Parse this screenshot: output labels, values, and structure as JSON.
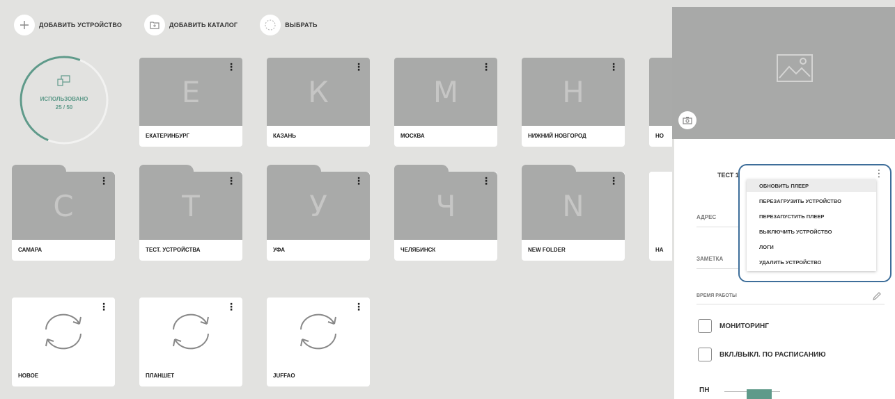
{
  "toolbar": {
    "add_device": "ДОБАВИТЬ УСТРОЙСТВО",
    "add_catalog": "ДОБАВИТЬ КАТАЛОГ",
    "select": "ВЫБРАТЬ"
  },
  "usage": {
    "label": "ИСПОЛЬЗОВАНО",
    "count": "25 / 50",
    "used": 25,
    "total": 50,
    "color": "#5f9a8a"
  },
  "row1": [
    {
      "letter": "Е",
      "name": "ЕКАТЕРИНБУРГ"
    },
    {
      "letter": "К",
      "name": "КАЗАНЬ"
    },
    {
      "letter": "М",
      "name": "МОСКВА"
    },
    {
      "letter": "Н",
      "name": "НИЖНИЙ НОВГОРОД"
    },
    {
      "letter": "",
      "name": "НО"
    }
  ],
  "row2": [
    {
      "letter": "С",
      "name": "САМАРА"
    },
    {
      "letter": "Т",
      "name": "ТЕСТ. УСТРОЙСТВА"
    },
    {
      "letter": "У",
      "name": "УФА"
    },
    {
      "letter": "Ч",
      "name": "ЧЕЛЯБИНСК"
    },
    {
      "letter": "N",
      "name": "NEW FOLDER"
    },
    {
      "letter": "",
      "name": "НА"
    }
  ],
  "row3": [
    {
      "name": "НОВОЕ"
    },
    {
      "name": "ПЛАНШЕТ"
    },
    {
      "name": "JUFFAO"
    }
  ],
  "panel": {
    "device_title": "ТЕСТ 1",
    "address_label": "АДРЕС",
    "notes_label": "ЗАМЕТКА",
    "work_time_label": "ВРЕМЯ РАБОТЫ",
    "monitoring_label": "МОНИТОРИНГ",
    "schedule_label": "ВКЛ./ВЫКЛ. ПО РАСПИСАНИЮ",
    "day_label": "ПН"
  },
  "menu": {
    "items": [
      "ОБНОВИТЬ ПЛЕЕР",
      "ПЕРЕЗАГРУЗИТЬ УСТРОЙСТВО",
      "ПЕРЕЗАПУСТИТЬ ПЛЕЕР",
      "ВЫКЛЮЧИТЬ УСТРОЙСТВО",
      "ЛОГИ",
      "УДАЛИТЬ УСТРОЙСТВО"
    ]
  },
  "icons": {
    "add": "plus-icon",
    "catalog": "folder-icon",
    "select": "circle-select-icon",
    "usage": "devices-icon",
    "more": "more-vert-icon",
    "refresh": "refresh-icon",
    "image": "image-placeholder-icon",
    "camera": "camera-icon",
    "edit": "pencil-icon"
  }
}
